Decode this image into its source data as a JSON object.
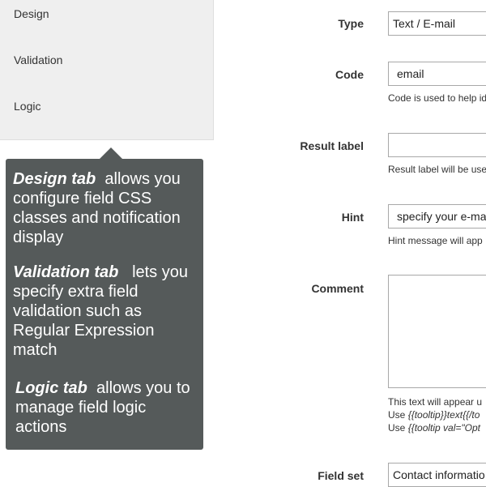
{
  "sidebar": {
    "items": [
      {
        "label": "Design"
      },
      {
        "label": "Validation"
      },
      {
        "label": "Logic"
      }
    ]
  },
  "tooltip": {
    "design_title": "Design tab",
    "design_text": "allows you configure field CSS classes and notification display",
    "validation_title": "Validation tab",
    "validation_text": "lets you specify extra field validation such as Regular Expression match",
    "logic_title": "Logic tab",
    "logic_text": "allows you to manage field logic actions"
  },
  "form": {
    "type": {
      "label": "Type",
      "value": "Text / E-mail"
    },
    "code": {
      "label": "Code",
      "value": "email",
      "help": "Code is used to help id"
    },
    "result_label": {
      "label": "Result label",
      "value": "",
      "help": "Result label will be use"
    },
    "hint": {
      "label": "Hint",
      "value": "specify your e-ma",
      "help": "Hint message will app"
    },
    "comment": {
      "label": "Comment",
      "value": "",
      "help1": "This text will appear u",
      "help2_prefix": "Use ",
      "help2_code": "{{tooltip}}text{{/to",
      "help3_prefix": "Use ",
      "help3_code": "{{tooltip val=\"Opt"
    },
    "field_set": {
      "label": "Field set",
      "value": "Contact informatio"
    }
  }
}
